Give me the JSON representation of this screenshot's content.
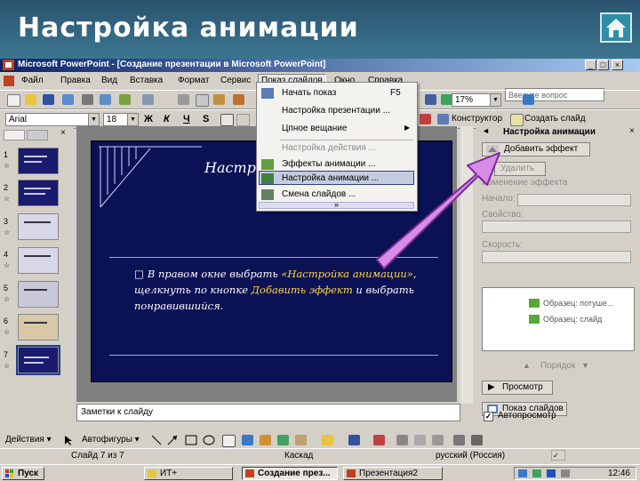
{
  "slide": {
    "title": "Настройка анимации"
  },
  "window": {
    "title": "Microsoft PowerPoint - [Создание презентации в Microsoft PowerPoint]"
  },
  "menu": {
    "items": [
      {
        "label": "Файл"
      },
      {
        "label": "Правка"
      },
      {
        "label": "Вид"
      },
      {
        "label": "Вставка"
      },
      {
        "label": "Формат"
      },
      {
        "label": "Сервис"
      },
      {
        "label": "Показ слайдов"
      },
      {
        "label": "Окно"
      },
      {
        "label": "Справка"
      }
    ],
    "help_placeholder": "Введите вопрос"
  },
  "toolbar": {
    "zoom": "17%"
  },
  "format_bar": {
    "font": "Arial",
    "size": "18",
    "bold": "Ж",
    "italic": "К",
    "underline": "Ч",
    "shadow": "S",
    "designer": "Конструктор",
    "new_slide": "Создать слайд"
  },
  "dropdown": {
    "items": [
      {
        "label": "Начать показ",
        "shortcut": "F5"
      },
      {
        "label": "Настройка презентации ..."
      },
      {
        "label": "Цпное вещание"
      },
      {
        "label": "Настройка действия ..."
      },
      {
        "label": "Эффекты анимации ..."
      },
      {
        "label": "Настройка анимации ..."
      },
      {
        "label": "Смена слайдов ..."
      }
    ],
    "expand": "»"
  },
  "thumbnails": {
    "items": [
      {
        "num": "1",
        "star": "☆"
      },
      {
        "num": "2",
        "star": "☆"
      },
      {
        "num": "3",
        "star": "☆"
      },
      {
        "num": "4",
        "star": "☆"
      },
      {
        "num": "5",
        "star": "☆"
      },
      {
        "num": "6",
        "star": "☆"
      },
      {
        "num": "7",
        "star": "☆"
      }
    ]
  },
  "editor": {
    "slide_title": "Настр",
    "bullet": "□",
    "body_p1": "В правом окне выбрать ",
    "body_hl1": "«Настройка анимации»",
    "body_p2": ", щелкнуть по кнопке ",
    "body_hl2": "Добавить эффект",
    "body_p3": " и выбрать понравившийся.",
    "notes": "Заметки к слайду"
  },
  "taskpane": {
    "title": "Настройка анимации",
    "add_effect": "Добавить эффект",
    "remove": "Удалить",
    "modify_label": "Изменение эффекта",
    "start_label": "Начало:",
    "property_label": "Свойство:",
    "speed_label": "Скорость:",
    "list_items": [
      {
        "label": "Образец: потуше..."
      },
      {
        "label": "Образец: слайд"
      }
    ],
    "order_label": "Порядок",
    "play": "Просмотр",
    "slideshow": "Показ слайдов",
    "autopreview": "Автопросмотр",
    "checkmark": "✓"
  },
  "drawbar": {
    "actions": "Действия ▾",
    "autoshapes": "Автофигуры ▾"
  },
  "status": {
    "slide": "Слайд 7 из 7",
    "design": "Каскад",
    "lang": "русский (Россия)"
  },
  "taskbar": {
    "start": "Пуск",
    "items": [
      {
        "label": "ИТ+"
      },
      {
        "label": "Создание през..."
      },
      {
        "label": "Презентация2"
      }
    ],
    "clock": "12:46"
  },
  "colors": {
    "highlight": "#ffd54a",
    "slide_bg": "#0b1155",
    "arrow": "#d88ce8"
  }
}
